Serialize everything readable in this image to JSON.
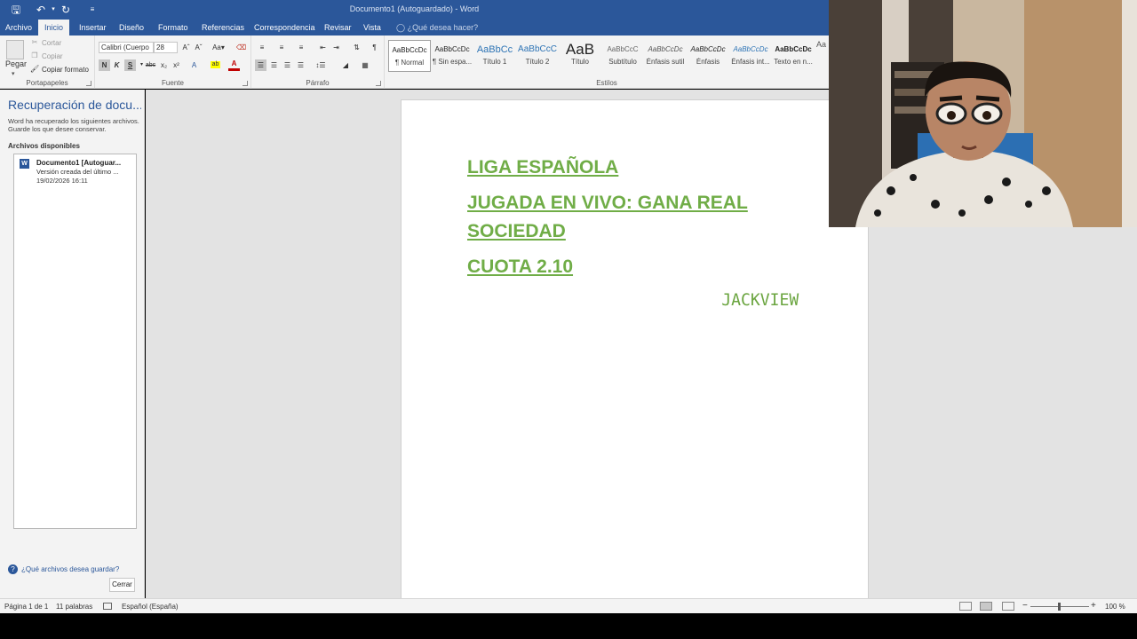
{
  "window": {
    "title": "Documento1 (Autoguardado) - Word",
    "tell_me": "¿Qué desea hacer?",
    "accent": "#2b579a"
  },
  "tabs": [
    "Archivo",
    "Inicio",
    "Insertar",
    "Diseño",
    "Formato",
    "Referencias",
    "Correspondencia",
    "Revisar",
    "Vista"
  ],
  "ribbon": {
    "clipboard": {
      "paste": "Pegar",
      "cut": "Cortar",
      "copy": "Copiar",
      "format_painter": "Copiar formato",
      "label": "Portapapeles"
    },
    "font": {
      "name": "Calibri (Cuerpo",
      "size": "28",
      "bold": "N",
      "italic": "K",
      "underline": "S",
      "label": "Fuente"
    },
    "paragraph": {
      "label": "Párrafo"
    },
    "styles": {
      "label": "Estilos",
      "items": [
        {
          "sample": "AaBbCcDc",
          "name": "¶ Normal"
        },
        {
          "sample": "AaBbCcDc",
          "name": "¶ Sin espa..."
        },
        {
          "sample": "AaBbCc",
          "name": "Título 1"
        },
        {
          "sample": "AaBbCcC",
          "name": "Título 2"
        },
        {
          "sample": "AaB",
          "name": "Título"
        },
        {
          "sample": "AaBbCcC",
          "name": "Subtítulo"
        },
        {
          "sample": "AaBbCcDc",
          "name": "Énfasis sutil"
        },
        {
          "sample": "AaBbCcDc",
          "name": "Énfasis"
        },
        {
          "sample": "AaBbCcDc",
          "name": "Énfasis int..."
        },
        {
          "sample": "AaBbCcDc",
          "name": "Texto en n..."
        }
      ]
    }
  },
  "recovery": {
    "title": "Recuperación de docu...",
    "description": "Word ha recuperado los siguientes archivos. Guarde los que desee conservar.",
    "available_label": "Archivos disponibles",
    "file": {
      "name": "Documento1 [Autoguar...",
      "version": "Versión creada del último ...",
      "date": "19/02/2026 16:11"
    },
    "help_link": "¿Qué archivos desea guardar?",
    "close_button": "Cerrar"
  },
  "document": {
    "line1": "LIGA ESPAÑOLA",
    "line2": "JUGADA EN VIVO: GANA REAL",
    "line3": "SOCIEDAD",
    "line4": "CUOTA 2.10",
    "signature": "JACKVIEW",
    "text_color": "#70ad47"
  },
  "statusbar": {
    "page": "Página 1 de 1",
    "words": "11 palabras",
    "language": "Español (España)",
    "zoom": "100 %",
    "zoom_minus": "−",
    "zoom_plus": "+"
  }
}
